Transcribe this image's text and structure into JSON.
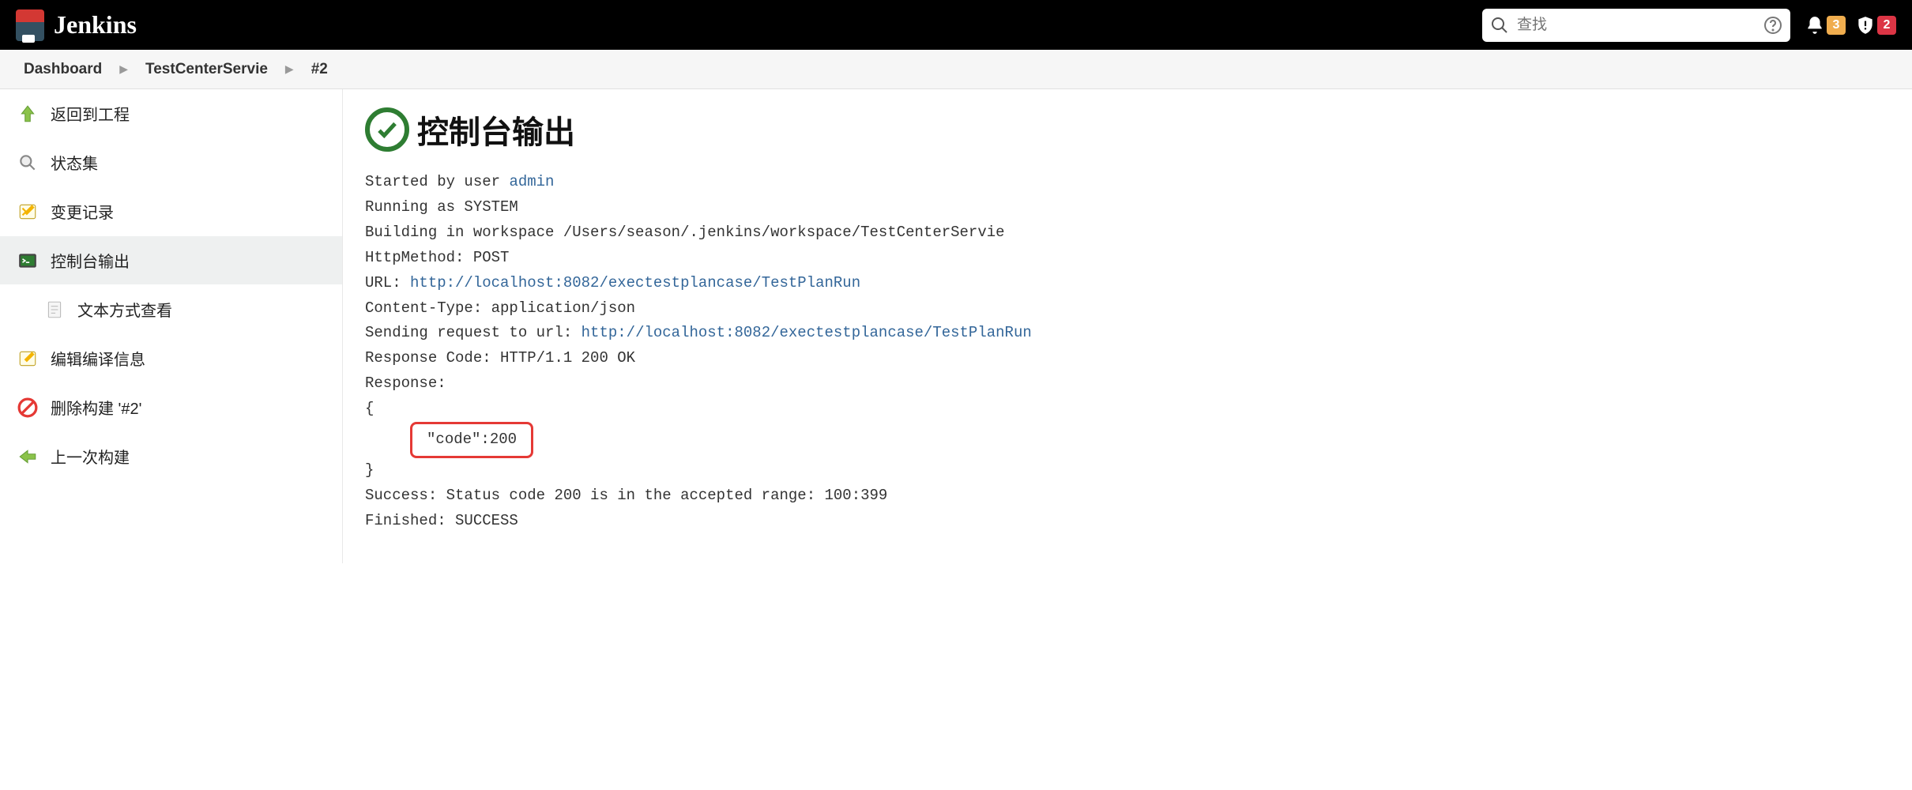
{
  "header": {
    "brand": "Jenkins",
    "search_placeholder": "查找",
    "badge_notifications": "3",
    "badge_alerts": "2"
  },
  "breadcrumb": {
    "items": [
      "Dashboard",
      "TestCenterServie",
      "#2"
    ]
  },
  "sidebar": {
    "items": [
      {
        "label": "返回到工程"
      },
      {
        "label": "状态集"
      },
      {
        "label": "变更记录"
      },
      {
        "label": "控制台输出"
      },
      {
        "label": "文本方式查看"
      },
      {
        "label": "编辑编译信息"
      },
      {
        "label": "删除构建 '#2'"
      },
      {
        "label": "上一次构建"
      }
    ]
  },
  "page": {
    "title": "控制台输出"
  },
  "console": {
    "line1_pre": "Started by user ",
    "line1_link": "admin",
    "line2": "Running as SYSTEM",
    "line3": "Building in workspace /Users/season/.jenkins/workspace/TestCenterServie",
    "line4": "HttpMethod: POST",
    "line5_pre": "URL: ",
    "line5_link": "http://localhost:8082/exectestplancase/TestPlanRun",
    "line6": "Content-Type: application/json",
    "line7_pre": "Sending request to url: ",
    "line7_link": "http://localhost:8082/exectestplancase/TestPlanRun",
    "line8": "Response Code: HTTP/1.1 200 OK",
    "line9": "Response: ",
    "line10": "{",
    "line11": "\"code\":200",
    "line12": "}",
    "line13": "Success: Status code 200 is in the accepted range: 100:399",
    "line14": "Finished: SUCCESS"
  }
}
